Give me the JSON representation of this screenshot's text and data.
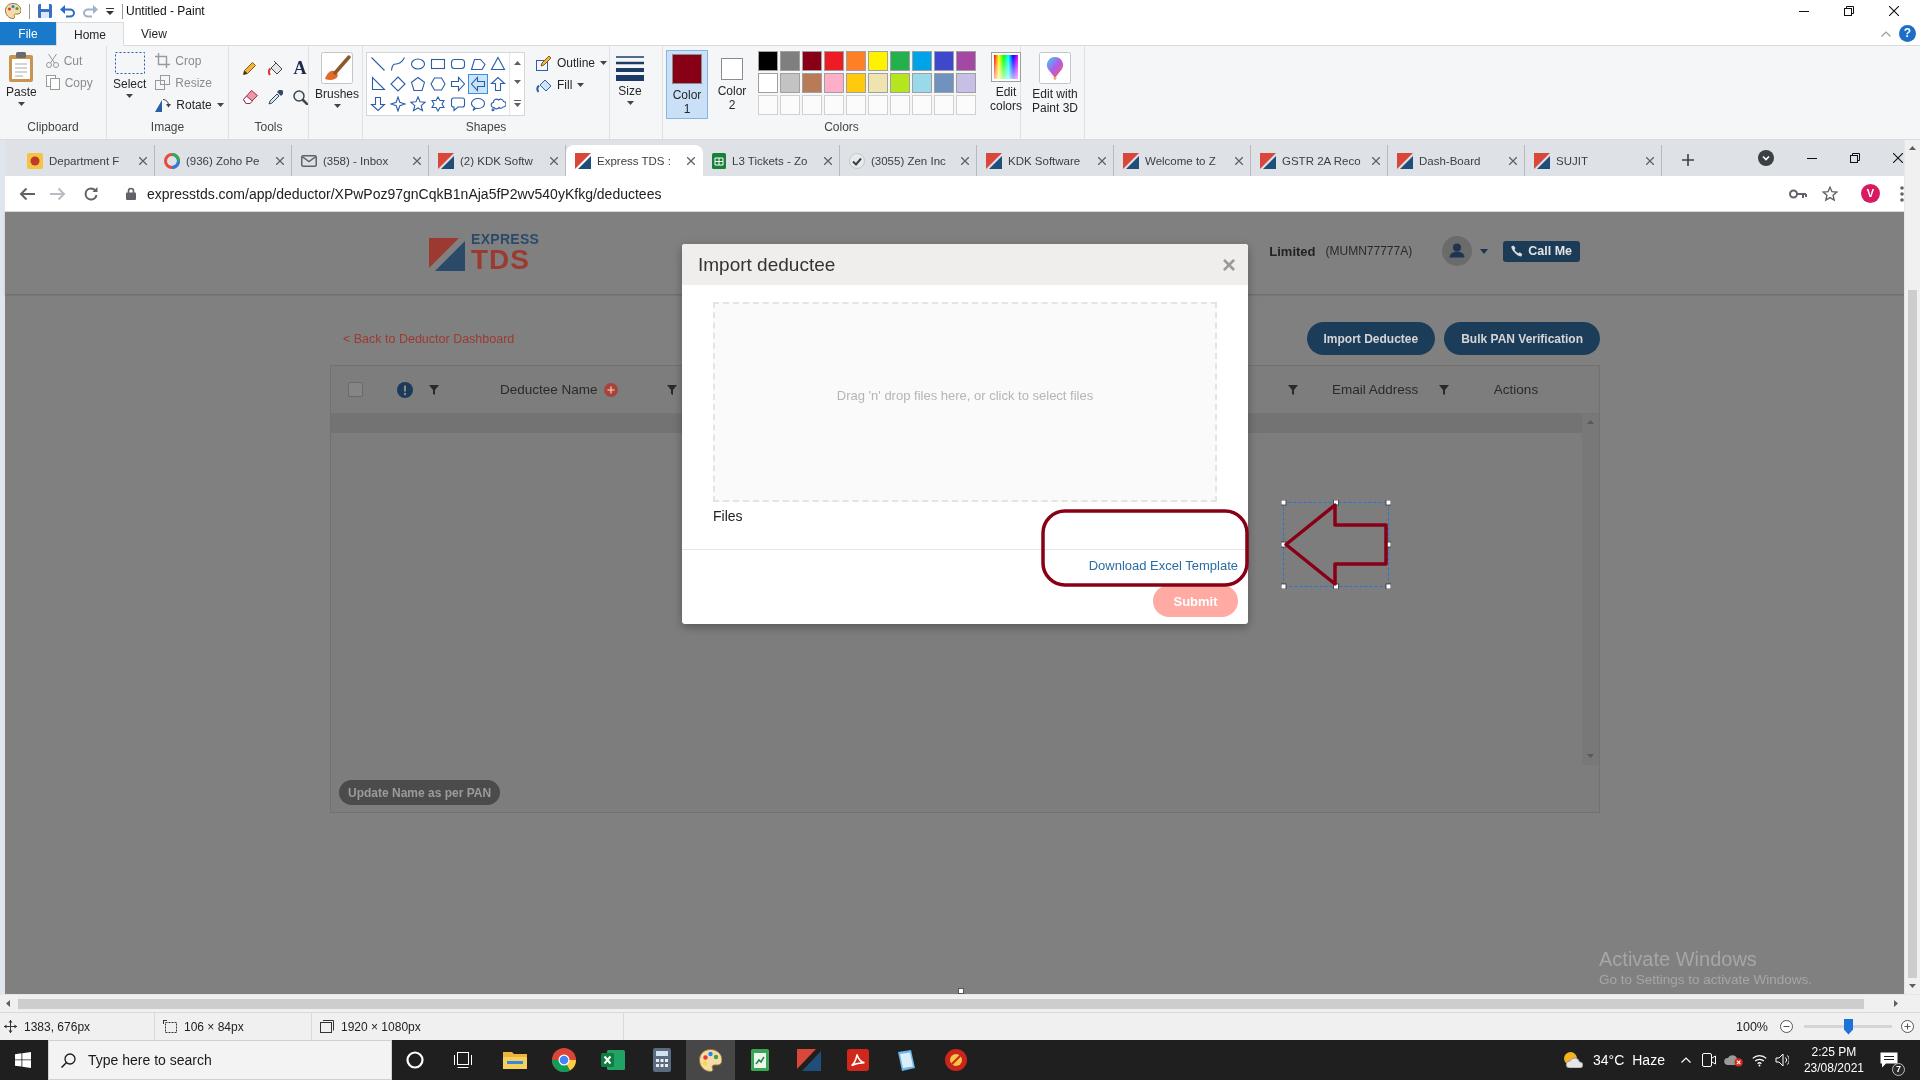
{
  "paint_window": {
    "title": "Untitled - Paint",
    "help": "?"
  },
  "ribbon_tabs": [
    {
      "label": "File",
      "kind": "file",
      "selected": false
    },
    {
      "label": "Home",
      "kind": "tab",
      "selected": true
    },
    {
      "label": "View",
      "kind": "tab",
      "selected": false
    }
  ],
  "ribbon": {
    "clipboard": {
      "label": "Clipboard",
      "paste": "Paste",
      "cut": {
        "label": "Cut",
        "disabled": true
      },
      "copy": {
        "label": "Copy",
        "disabled": true
      }
    },
    "image": {
      "label": "Image",
      "select": "Select",
      "crop": {
        "label": "Crop",
        "disabled": true
      },
      "resize": {
        "label": "Resize",
        "disabled": true
      },
      "rotate": {
        "label": "Rotate",
        "disabled": false
      }
    },
    "tools": {
      "label": "Tools",
      "text_tool": "A"
    },
    "brushes": {
      "label": "Brushes"
    },
    "shapes": {
      "label": "Shapes",
      "gallery": [
        {
          "kind": "line",
          "selected": false
        },
        {
          "kind": "curve",
          "selected": false
        },
        {
          "kind": "oval",
          "selected": false
        },
        {
          "kind": "rectangle",
          "selected": false
        },
        {
          "kind": "rounded_rectangle",
          "selected": false
        },
        {
          "kind": "polygon",
          "selected": false
        },
        {
          "kind": "triangle",
          "selected": false
        },
        {
          "kind": "right_triangle",
          "selected": false
        },
        {
          "kind": "diamond",
          "selected": false
        },
        {
          "kind": "pentagon",
          "selected": false
        },
        {
          "kind": "hexagon",
          "selected": false
        },
        {
          "kind": "right_arrow",
          "selected": false
        },
        {
          "kind": "left_arrow",
          "selected": true
        },
        {
          "kind": "up_arrow",
          "selected": false
        },
        {
          "kind": "down_arrow",
          "selected": false
        },
        {
          "kind": "four_point_star",
          "selected": false
        },
        {
          "kind": "five_point_star",
          "selected": false
        },
        {
          "kind": "six_point_star",
          "selected": false
        },
        {
          "kind": "rounded_callout",
          "selected": false
        },
        {
          "kind": "oval_callout",
          "selected": false
        },
        {
          "kind": "cloud_callout",
          "selected": false
        }
      ],
      "outline": "Outline",
      "fill": "Fill"
    },
    "size": {
      "label": "Size"
    },
    "colors": {
      "label": "Colors",
      "color_1": {
        "label": "Color 1",
        "color": "#880015",
        "selected": true
      },
      "color_2": {
        "label": "Color 2",
        "color": "#ffffff",
        "selected": false
      },
      "palette": [
        {
          "color": "#000000"
        },
        {
          "color": "#7f7f7f"
        },
        {
          "color": "#880015"
        },
        {
          "color": "#ed1c24"
        },
        {
          "color": "#ff7f27"
        },
        {
          "color": "#fff200"
        },
        {
          "color": "#22b14c"
        },
        {
          "color": "#00a2e8"
        },
        {
          "color": "#3f48cc"
        },
        {
          "color": "#a349a4"
        },
        {
          "color": "#ffffff"
        },
        {
          "color": "#c3c3c3"
        },
        {
          "color": "#b97a57"
        },
        {
          "color": "#ffaec9"
        },
        {
          "color": "#ffc90e"
        },
        {
          "color": "#efe4b0"
        },
        {
          "color": "#b5e61d"
        },
        {
          "color": "#99d9ea"
        },
        {
          "color": "#7092be"
        },
        {
          "color": "#c8bfe7"
        },
        {
          "kind": "empty"
        },
        {
          "kind": "empty"
        },
        {
          "kind": "empty"
        },
        {
          "kind": "empty"
        },
        {
          "kind": "empty"
        },
        {
          "kind": "empty"
        },
        {
          "kind": "empty"
        },
        {
          "kind": "empty"
        },
        {
          "kind": "empty"
        },
        {
          "kind": "empty"
        }
      ],
      "edit_colors": "Edit colors"
    },
    "paint_3d": {
      "label": "Edit with Paint 3D"
    }
  },
  "browser": {
    "tabs": [
      {
        "title": "Department F",
        "kind": "emblem",
        "selected": false
      },
      {
        "title": "(936) Zoho Pe",
        "kind": "ring",
        "selected": false
      },
      {
        "title": "(358) - Inbox",
        "kind": "mail",
        "selected": false
      },
      {
        "title": "(2) KDK Softw",
        "kind": "logo",
        "selected": false
      },
      {
        "title": "Express TDS :",
        "kind": "logo",
        "selected": true
      },
      {
        "title": "L3 Tickets - Zo",
        "kind": "sheet",
        "selected": false
      },
      {
        "title": "(3055) Zen Inc",
        "kind": "check",
        "selected": false
      },
      {
        "title": "KDK Software",
        "kind": "logo",
        "selected": false
      },
      {
        "title": "Welcome to Z",
        "kind": "logo",
        "selected": false
      },
      {
        "title": "GSTR 2A Reco",
        "kind": "logo",
        "selected": false
      },
      {
        "title": "Dash-Board",
        "kind": "logo",
        "selected": false
      },
      {
        "title": "SUJIT",
        "kind": "logo",
        "selected": false
      }
    ],
    "url": "expresstds.com/app/deductor/XPwPoz97gnCqkB1nAja5fP2wv540yKfkg/deductees",
    "profile_initial": "V"
  },
  "page": {
    "logo": {
      "line_1": "EXPRESS",
      "line_2": "TDS"
    },
    "company": "Limited",
    "company_code": "(MUMN77777A)",
    "call_button": "Call Me",
    "back_link": "< Back to Deductor Dashboard",
    "actions": [
      "Import Deductee",
      "Bulk PAN Verification"
    ],
    "table": {
      "columns": [
        {
          "kind": "select",
          "checked": false
        },
        {
          "kind": "info",
          "filter": true
        },
        {
          "kind": "text",
          "label": "Deductee Name",
          "add": true,
          "filter": true
        },
        {
          "kind": "covered",
          "filter": true
        },
        {
          "kind": "text",
          "label": "Email Address",
          "add": false,
          "filter": true
        },
        {
          "kind": "text",
          "label": "Actions",
          "add": false,
          "filter": false
        }
      ]
    },
    "update_button": "Update Name as per PAN"
  },
  "dialog": {
    "title": "Import deductee",
    "close": "×",
    "dropzone": {
      "prompt": "Drag 'n' drop files here, or click to select files"
    },
    "files_label": "Files",
    "template_link": "Download Excel Template",
    "submit": {
      "label": "Submit",
      "disabled": true
    }
  },
  "annotations": [
    {
      "kind": "rounded_rectangle",
      "selected": false
    },
    {
      "kind": "left_arrow",
      "selected": true
    }
  ],
  "status_bar": {
    "cursor_position": "1383, 676px",
    "selection_size": "106 × 84px",
    "image_size": "1920 × 1080px",
    "zoom": "100%",
    "zoom_slider": {
      "level": 0.5
    }
  },
  "taskbar": {
    "search": {
      "placeholder": "Type here to search"
    },
    "apps": [
      {
        "kind": "folder",
        "selected": false
      },
      {
        "kind": "browser",
        "selected": false
      },
      {
        "kind": "spreadsheet",
        "selected": false
      },
      {
        "kind": "calculator",
        "selected": false
      },
      {
        "kind": "palette",
        "selected": true
      },
      {
        "kind": "notepad",
        "selected": false
      },
      {
        "kind": "logo",
        "selected": false
      },
      {
        "kind": "pdf",
        "selected": false
      },
      {
        "kind": "book",
        "selected": false
      },
      {
        "kind": "badge",
        "selected": false
      }
    ],
    "weather": {
      "temperature": "34°C",
      "condition": "Haze"
    },
    "time": "2:25 PM",
    "date": "23/08/2021",
    "notification_count": "7"
  },
  "activation_notice": {
    "title": "Activate Windows",
    "text": "Go to Settings to activate Windows."
  }
}
